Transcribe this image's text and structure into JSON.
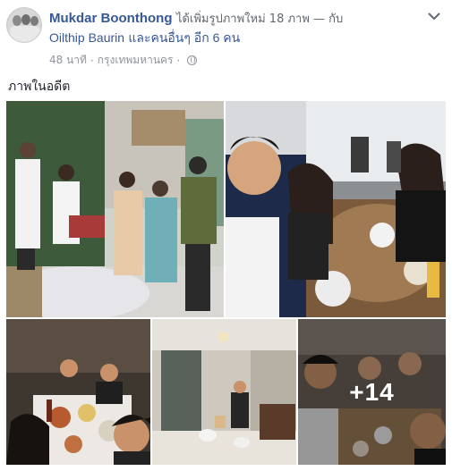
{
  "post": {
    "author": "Mukdar Boonthong",
    "action": "ได้เพิ่มรูปภาพใหม่ 18 ภาพ — กับ",
    "tagged": "Oilthip Baurin",
    "others": "และคนอื่นๆ อีก 6 คน",
    "time": "48 นาที",
    "location": "กรุงเทพมหานคร",
    "caption": "ภาพในอดีต",
    "more_photos": "+14",
    "icons": {
      "menu": "chevron-down-icon",
      "privacy": "globe-icon"
    }
  }
}
